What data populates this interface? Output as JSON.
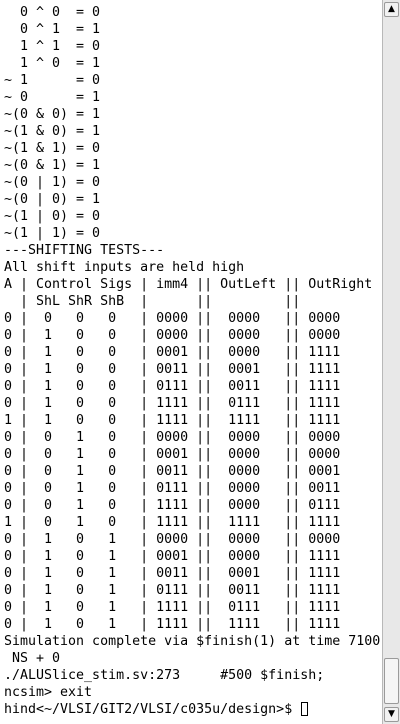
{
  "terminal": {
    "lines": [
      "  0 ^ 0  = 0",
      "  0 ^ 1  = 1",
      "  1 ^ 1  = 0",
      "  1 ^ 0  = 1",
      "~ 1      = 0",
      "~ 0      = 1",
      "~(0 & 0) = 1",
      "~(1 & 0) = 1",
      "~(1 & 1) = 0",
      "~(0 & 1) = 1",
      "~(0 | 1) = 0",
      "~(0 | 0) = 1",
      "~(1 | 0) = 0",
      "~(1 | 1) = 0",
      "---SHIFTING TESTS---",
      "All shift inputs are held high",
      "A | Control Sigs | imm4 || OutLeft || OutRight",
      "  | ShL ShR ShB  |      ||         ||",
      "0 |  0   0   0   | 0000 ||  0000   || 0000",
      "0 |  1   0   0   | 0000 ||  0000   || 0000",
      "0 |  1   0   0   | 0001 ||  0000   || 1111",
      "0 |  1   0   0   | 0011 ||  0001   || 1111",
      "0 |  1   0   0   | 0111 ||  0011   || 1111",
      "0 |  1   0   0   | 1111 ||  0111   || 1111",
      "1 |  1   0   0   | 1111 ||  1111   || 1111",
      "0 |  0   1   0   | 0000 ||  0000   || 0000",
      "0 |  0   1   0   | 0001 ||  0000   || 0000",
      "0 |  0   1   0   | 0011 ||  0000   || 0001",
      "0 |  0   1   0   | 0111 ||  0000   || 0011",
      "0 |  0   1   0   | 1111 ||  0000   || 0111",
      "1 |  0   1   0   | 1111 ||  1111   || 1111",
      "0 |  1   0   1   | 0000 ||  0000   || 0000",
      "0 |  1   0   1   | 0001 ||  0000   || 1111",
      "0 |  1   0   1   | 0011 ||  0001   || 1111",
      "0 |  1   0   1   | 0111 ||  0011   || 1111",
      "0 |  1   0   1   | 1111 ||  0111   || 1111",
      "0 |  1   0   1   | 1111 ||  1111   || 1111",
      "Simulation complete via $finish(1) at time 7100",
      " NS + 0",
      "./ALUSlice_stim.sv:273     #500 $finish;",
      "ncsim> exit"
    ],
    "prompt": "hind<~/VLSI/GIT2/VLSI/c035u/design>$ "
  },
  "scrollbar": {
    "up_icon": "▲",
    "down_icon": "▼"
  }
}
